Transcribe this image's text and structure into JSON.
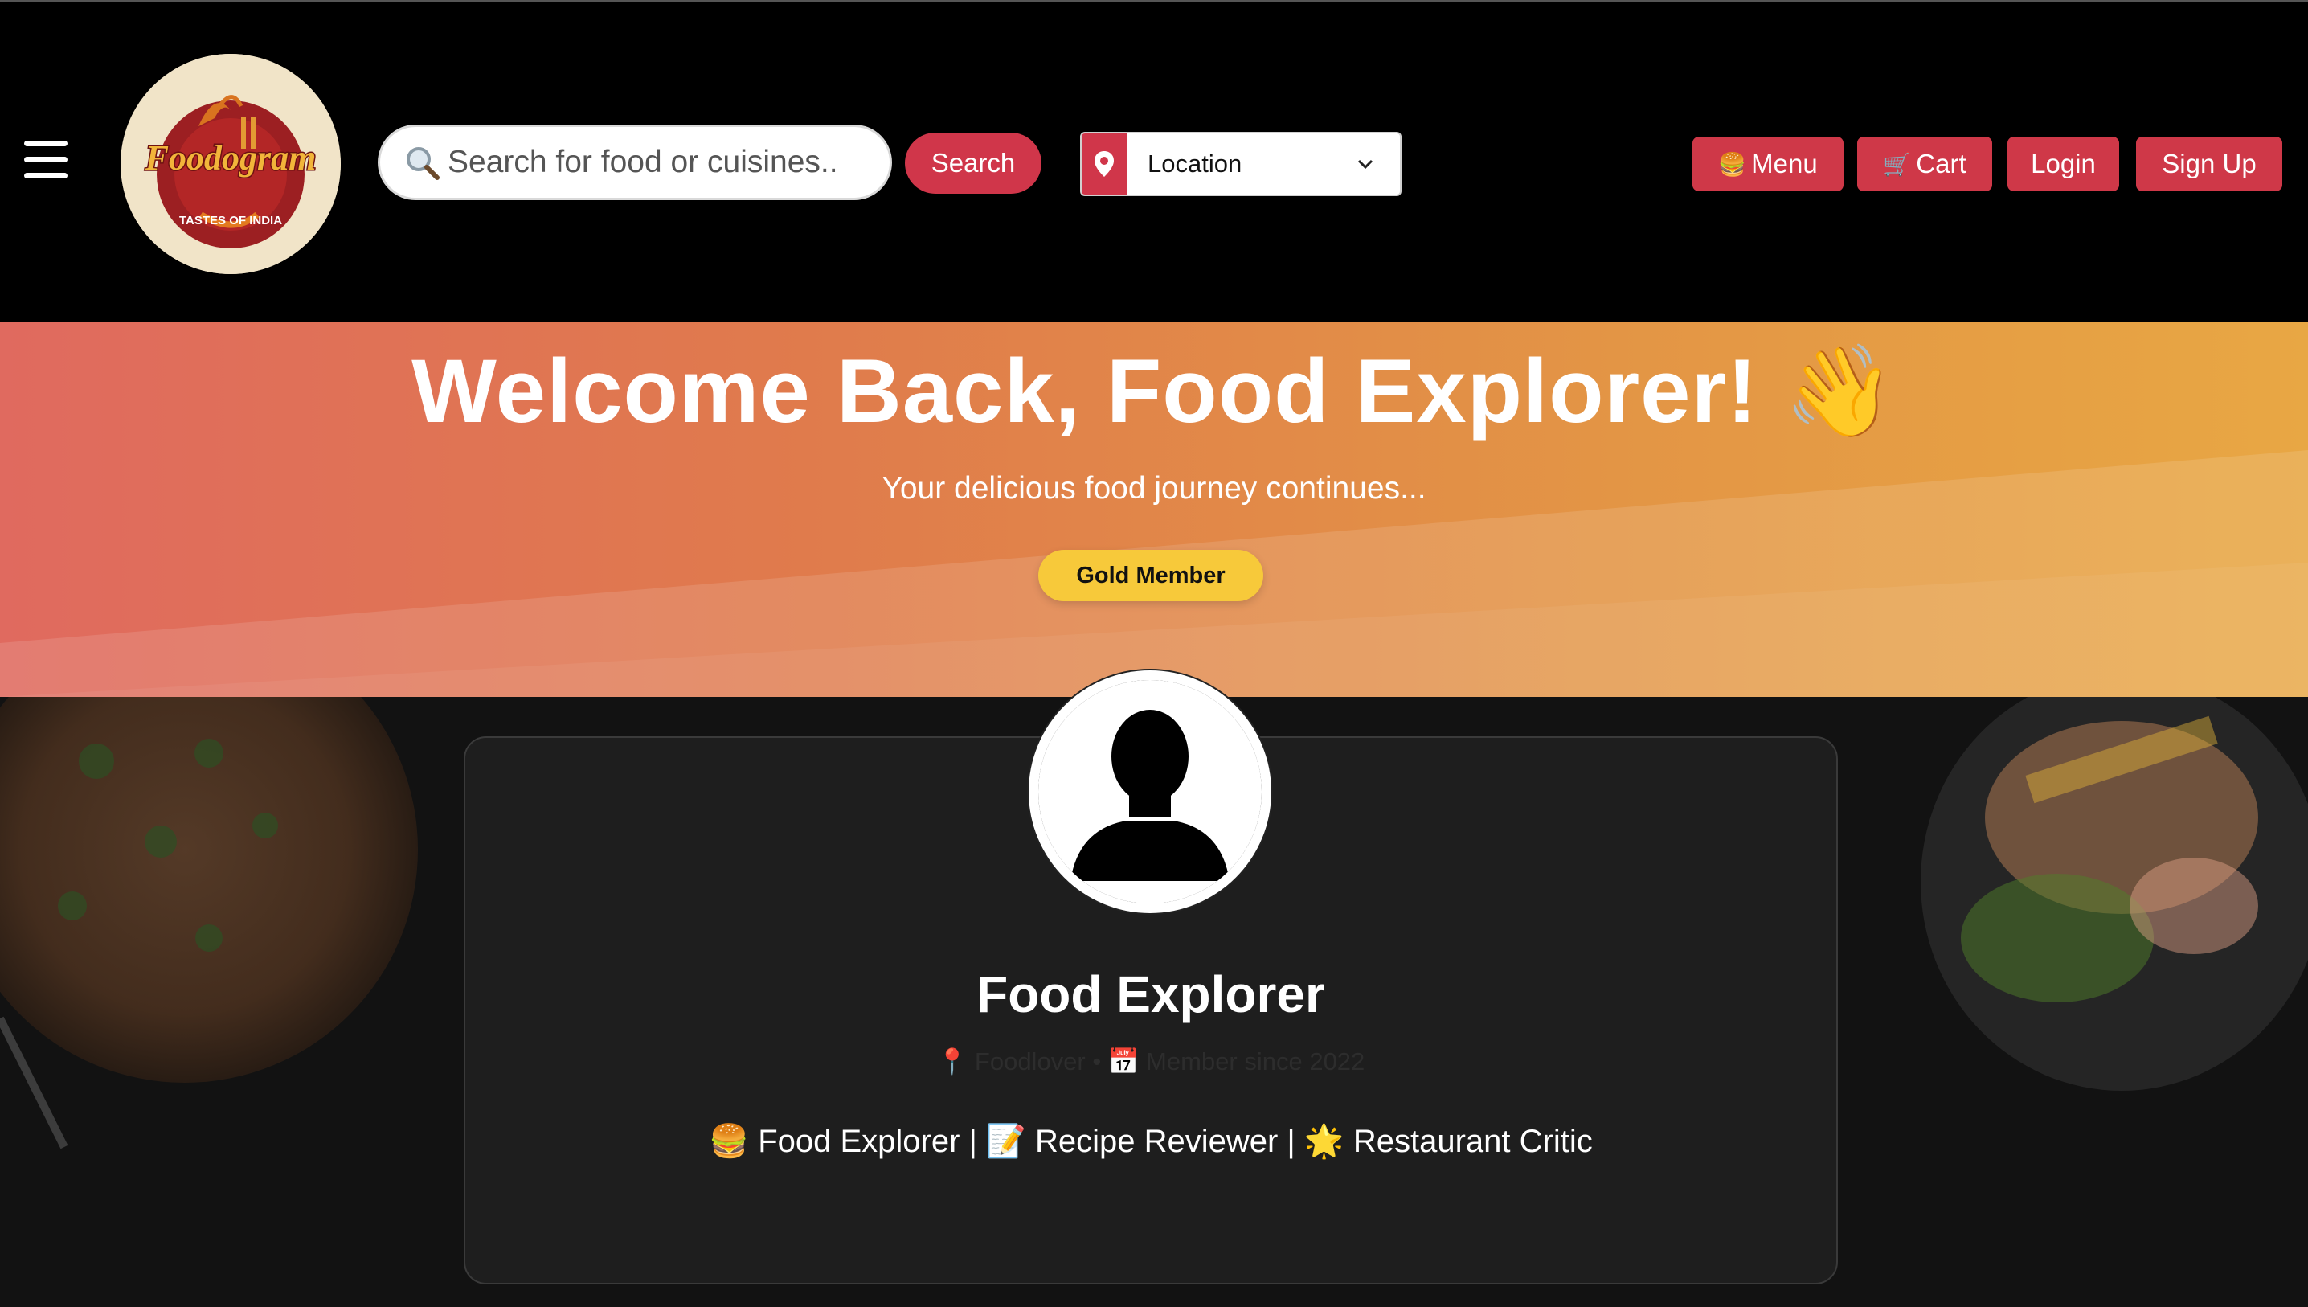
{
  "header": {
    "logo": {
      "brand": "Foodogram",
      "tagline": "TASTES OF INDIA"
    },
    "search": {
      "placeholder": "Search for food or cuisines..",
      "button_label": "Search"
    },
    "location": {
      "selected": "Location"
    },
    "nav": [
      {
        "label": "Menu",
        "icon": "🍔"
      },
      {
        "label": "Cart",
        "icon": "🛒"
      },
      {
        "label": "Login"
      },
      {
        "label": "Sign Up"
      }
    ]
  },
  "hero": {
    "title": "Welcome Back, Food Explorer! 👋",
    "subtitle": "Your delicious food journey continues...",
    "badge": "Gold Member"
  },
  "profile": {
    "name": "Food Explorer",
    "meta": "📍 Foodlover • 📅 Member since 2022",
    "tags": "🍔 Food Explorer | 📝 Recipe Reviewer | 🌟 Restaurant Critic"
  },
  "colors": {
    "accent": "#cf3848",
    "badge": "#f7c93a",
    "hero_start": "#e06a5f",
    "hero_end": "#e8a744"
  }
}
